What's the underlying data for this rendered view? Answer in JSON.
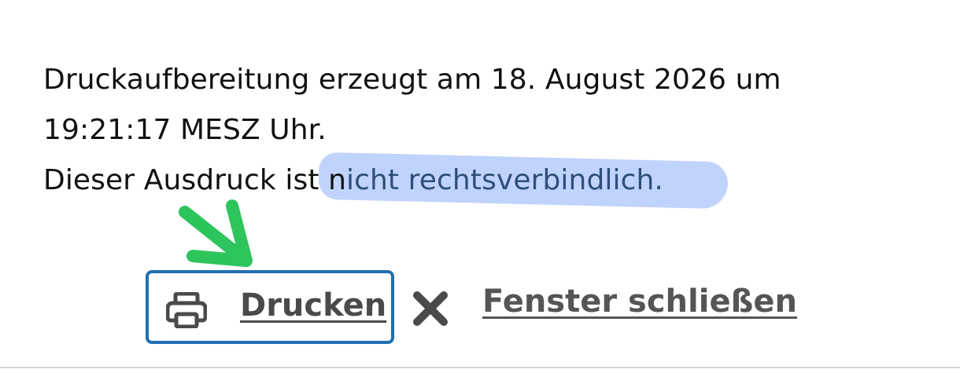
{
  "info": {
    "line1": "Druckaufbereitung erzeugt am 18. August 2026 um",
    "line2": "19:21:17 MESZ Uhr.",
    "line3_prefix": "Dieser Ausdruck ist ",
    "line3_n": "n",
    "line3_highlighted": "icht rechtsverbindlich."
  },
  "actions": {
    "print_label": "Drucken",
    "print_icon": "printer-icon",
    "close_label": "Fenster schließen",
    "close_icon": "close-icon"
  },
  "colors": {
    "highlight": "#8cb0fa",
    "arrow": "#2ec45c",
    "button_border": "#1f6fb0",
    "link_text": "#4a4a4a"
  }
}
